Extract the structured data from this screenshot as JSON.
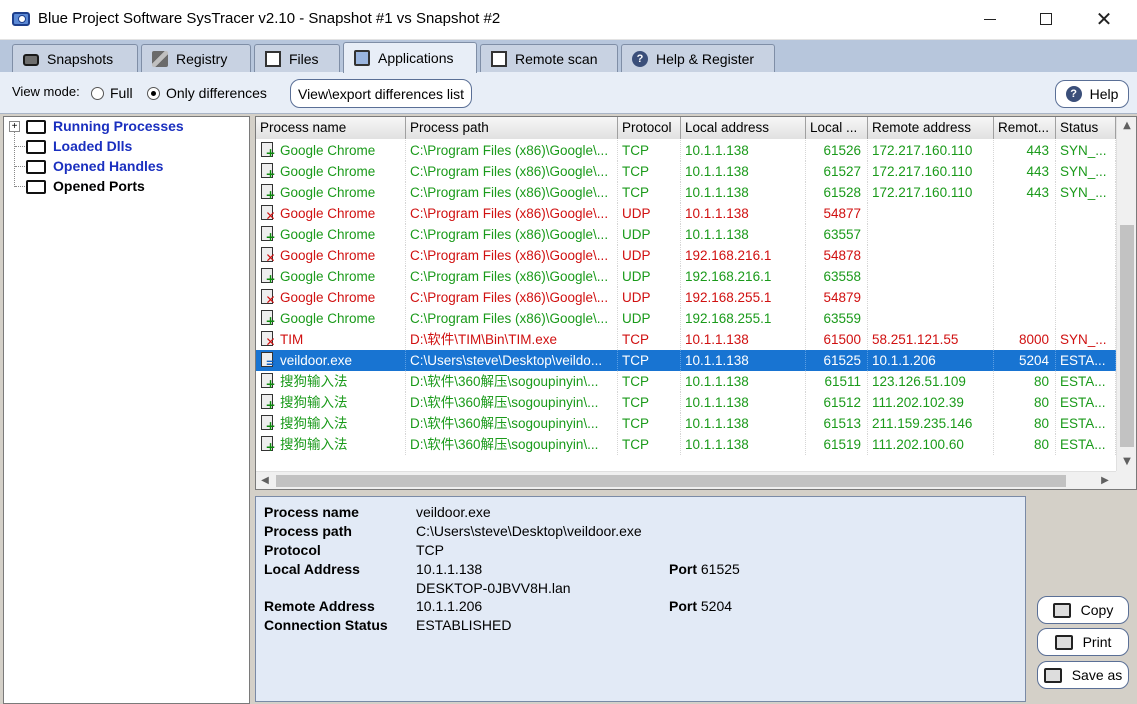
{
  "window": {
    "title": "Blue Project Software SysTracer v2.10 - Snapshot #1 vs Snapshot #2",
    "min_glyph": "—",
    "close_glyph": "✕"
  },
  "tabs": [
    {
      "label": "Snapshots",
      "icon": "camera-icon"
    },
    {
      "label": "Registry",
      "icon": "registry-icon"
    },
    {
      "label": "Files",
      "icon": "files-icon"
    },
    {
      "label": "Applications",
      "icon": "applications-icon",
      "active": true
    },
    {
      "label": "Remote scan",
      "icon": "remote-scan-icon"
    },
    {
      "label": "Help & Register",
      "icon": "help-icon"
    }
  ],
  "toolbar": {
    "view_mode_label": "View mode:",
    "full_label": "Full",
    "only_diff_label": "Only differences",
    "selected_mode": "Only differences",
    "export_button": "View\\export differences list",
    "help_button": "Help"
  },
  "tree": {
    "expander": "+",
    "items": [
      {
        "label": "Running Processes"
      },
      {
        "label": "Loaded Dlls"
      },
      {
        "label": "Opened Handles"
      },
      {
        "label": "Opened Ports",
        "selected": true
      }
    ]
  },
  "grid": {
    "columns": [
      "Process name",
      "Process path",
      "Protocol",
      "Local address",
      "Local ...",
      "Remote address",
      "Remot...",
      "Status"
    ],
    "rows": [
      {
        "state": "added",
        "name": "Google Chrome",
        "path": "C:\\Program Files (x86)\\Google\\...",
        "protocol": "TCP",
        "local_address": "10.1.1.138",
        "local_port": "61526",
        "remote_address": "172.217.160.110",
        "remote_port": "443",
        "status": "SYN_..."
      },
      {
        "state": "added",
        "name": "Google Chrome",
        "path": "C:\\Program Files (x86)\\Google\\...",
        "protocol": "TCP",
        "local_address": "10.1.1.138",
        "local_port": "61527",
        "remote_address": "172.217.160.110",
        "remote_port": "443",
        "status": "SYN_..."
      },
      {
        "state": "added",
        "name": "Google Chrome",
        "path": "C:\\Program Files (x86)\\Google\\...",
        "protocol": "TCP",
        "local_address": "10.1.1.138",
        "local_port": "61528",
        "remote_address": "172.217.160.110",
        "remote_port": "443",
        "status": "SYN_..."
      },
      {
        "state": "removed",
        "name": "Google Chrome",
        "path": "C:\\Program Files (x86)\\Google\\...",
        "protocol": "UDP",
        "local_address": "10.1.1.138",
        "local_port": "54877",
        "remote_address": "",
        "remote_port": "",
        "status": ""
      },
      {
        "state": "added",
        "name": "Google Chrome",
        "path": "C:\\Program Files (x86)\\Google\\...",
        "protocol": "UDP",
        "local_address": "10.1.1.138",
        "local_port": "63557",
        "remote_address": "",
        "remote_port": "",
        "status": ""
      },
      {
        "state": "removed",
        "name": "Google Chrome",
        "path": "C:\\Program Files (x86)\\Google\\...",
        "protocol": "UDP",
        "local_address": "192.168.216.1",
        "local_port": "54878",
        "remote_address": "",
        "remote_port": "",
        "status": ""
      },
      {
        "state": "added",
        "name": "Google Chrome",
        "path": "C:\\Program Files (x86)\\Google\\...",
        "protocol": "UDP",
        "local_address": "192.168.216.1",
        "local_port": "63558",
        "remote_address": "",
        "remote_port": "",
        "status": ""
      },
      {
        "state": "removed",
        "name": "Google Chrome",
        "path": "C:\\Program Files (x86)\\Google\\...",
        "protocol": "UDP",
        "local_address": "192.168.255.1",
        "local_port": "54879",
        "remote_address": "",
        "remote_port": "",
        "status": ""
      },
      {
        "state": "added",
        "name": "Google Chrome",
        "path": "C:\\Program Files (x86)\\Google\\...",
        "protocol": "UDP",
        "local_address": "192.168.255.1",
        "local_port": "63559",
        "remote_address": "",
        "remote_port": "",
        "status": ""
      },
      {
        "state": "removed",
        "name": "TIM",
        "path": "D:\\软件\\TIM\\Bin\\TIM.exe",
        "protocol": "TCP",
        "local_address": "10.1.1.138",
        "local_port": "61500",
        "remote_address": "58.251.121.55",
        "remote_port": "8000",
        "status": "SYN_..."
      },
      {
        "state": "selected",
        "name": "veildoor.exe",
        "path": "C:\\Users\\steve\\Desktop\\veildo...",
        "protocol": "TCP",
        "local_address": "10.1.1.138",
        "local_port": "61525",
        "remote_address": "10.1.1.206",
        "remote_port": "5204",
        "status": "ESTA..."
      },
      {
        "state": "added",
        "name": "搜狗输入法",
        "path": "D:\\软件\\360解压\\sogoupinyin\\...",
        "protocol": "TCP",
        "local_address": "10.1.1.138",
        "local_port": "61511",
        "remote_address": "123.126.51.109",
        "remote_port": "80",
        "status": "ESTA..."
      },
      {
        "state": "added",
        "name": "搜狗输入法",
        "path": "D:\\软件\\360解压\\sogoupinyin\\...",
        "protocol": "TCP",
        "local_address": "10.1.1.138",
        "local_port": "61512",
        "remote_address": "111.202.102.39",
        "remote_port": "80",
        "status": "ESTA..."
      },
      {
        "state": "added",
        "name": "搜狗输入法",
        "path": "D:\\软件\\360解压\\sogoupinyin\\...",
        "protocol": "TCP",
        "local_address": "10.1.1.138",
        "local_port": "61513",
        "remote_address": "211.159.235.146",
        "remote_port": "80",
        "status": "ESTA..."
      },
      {
        "state": "added",
        "name": "搜狗输入法",
        "path": "D:\\软件\\360解压\\sogoupinyin\\...",
        "protocol": "TCP",
        "local_address": "10.1.1.138",
        "local_port": "61519",
        "remote_address": "111.202.100.60",
        "remote_port": "80",
        "status": "ESTA..."
      }
    ]
  },
  "details": {
    "labels": {
      "process_name": "Process name",
      "process_path": "Process path",
      "protocol": "Protocol",
      "local_address": "Local Address",
      "remote_address": "Remote Address",
      "connection_status": "Connection Status",
      "port": "Port"
    },
    "process_name": "veildoor.exe",
    "process_path": "C:\\Users\\steve\\Desktop\\veildoor.exe",
    "protocol": "TCP",
    "local_address": "10.1.1.138",
    "local_host": "DESKTOP-0JBVV8H.lan",
    "local_port": "61525",
    "remote_address": "10.1.1.206",
    "remote_port": "5204",
    "connection_status": "ESTABLISHED"
  },
  "actions": {
    "copy": "Copy",
    "print": "Print",
    "save_as": "Save as"
  },
  "colors": {
    "added": "#1a9a1a",
    "removed": "#d01010",
    "selected": "#1874d2",
    "tree_text": "#1a2fbf"
  }
}
